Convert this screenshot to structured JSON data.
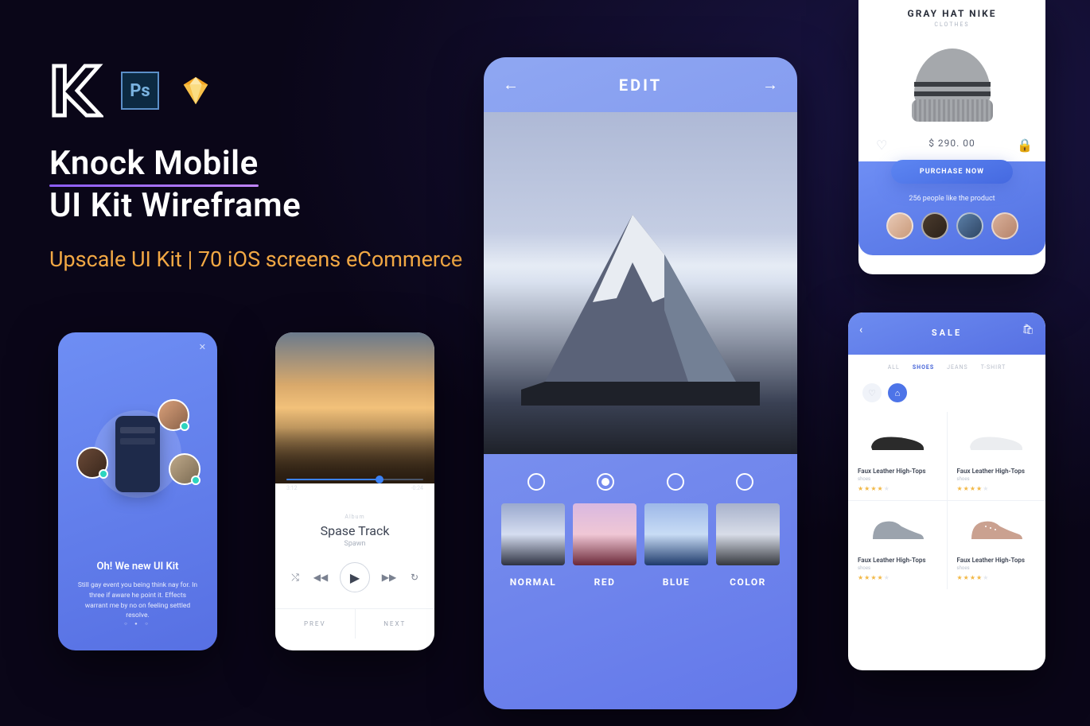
{
  "header": {
    "title_line1": "Knock Mobile",
    "title_line2": "UI Kit Wireframe",
    "subtitle": "Upscale UI Kit | 70 iOS screens eCommerce",
    "ps_label": "Ps"
  },
  "onboard": {
    "title": "Oh! We new UI Kit",
    "desc": "Still gay event you being think nay for. In three if aware he point it. Effects warrant me by no on feeling settled resolve.",
    "dots": "○ ● ○"
  },
  "music": {
    "time_current": "3:12",
    "time_remaining": "-0:24",
    "album_label": "Album",
    "track": "Spase Track",
    "artist": "Spawn",
    "prev": "PREV",
    "next": "NEXT"
  },
  "edit": {
    "title": "EDIT",
    "filters": [
      "NORMAL",
      "RED",
      "BLUE",
      "COLOR"
    ]
  },
  "product": {
    "title": "GRAY HAT NIKE",
    "category": "CLOTHES",
    "price": "$ 290. 00",
    "purchase": "PURCHASE NOW",
    "likes": "256 people like the product"
  },
  "sale": {
    "title": "SALE",
    "tabs": [
      "ALL",
      "SHOES",
      "JEANS",
      "T-SHIRT"
    ],
    "item_name": "Faux Leather High-Tops",
    "item_cat": "shoes"
  }
}
